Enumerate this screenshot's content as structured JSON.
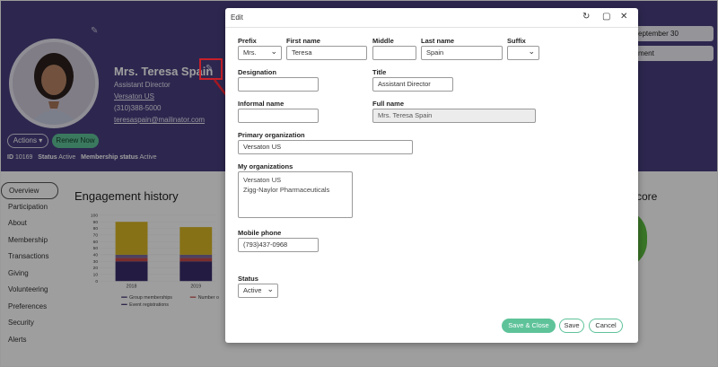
{
  "profile": {
    "name": "Mrs. Teresa Spain",
    "role": "Assistant Director",
    "org": "Versaton US",
    "phone": "(310)388-5000",
    "email": "teresaspain@mailinator.com",
    "actions_label": "Actions ▾",
    "renew_label": "Renew Now",
    "id_label": "ID",
    "id_value": "10169",
    "status_label": "Status",
    "status_value": "Active",
    "membership_status_label": "Membership status",
    "membership_status_value": "Active",
    "date_label": "eptember 30",
    "date2_label": "ment"
  },
  "sidebar": {
    "items": [
      {
        "label": "Overview"
      },
      {
        "label": "Participation"
      },
      {
        "label": "About"
      },
      {
        "label": "Membership"
      },
      {
        "label": "Transactions"
      },
      {
        "label": "Giving"
      },
      {
        "label": "Volunteering"
      },
      {
        "label": "Preferences"
      },
      {
        "label": "Security"
      },
      {
        "label": "Alerts"
      }
    ]
  },
  "main": {
    "engagement_title": "Engagement history",
    "score_title": "core"
  },
  "chart_data": {
    "type": "bar",
    "categories": [
      "2018",
      "2019"
    ],
    "series": [
      {
        "name": "Event registrations",
        "values": [
          30,
          30
        ],
        "color": "#3b2c6b"
      },
      {
        "name": "Number o",
        "values": [
          5,
          5
        ],
        "color": "#c44a4a"
      },
      {
        "name": "Group memberships",
        "values": [
          5,
          5
        ],
        "color": "#7c6a9a"
      },
      {
        "name": "",
        "values": [
          50,
          42
        ],
        "color": "#d9b724"
      }
    ],
    "ylim": [
      0,
      100
    ],
    "yticks": [
      "0",
      "10",
      "20",
      "30",
      "40",
      "50",
      "60",
      "70",
      "80",
      "90",
      "100"
    ],
    "legend": [
      "Group memberships",
      "Number o",
      "Event registrations"
    ]
  },
  "modal": {
    "title": "Edit",
    "labels": {
      "prefix": "Prefix",
      "first_name": "First name",
      "middle": "Middle",
      "last_name": "Last name",
      "suffix": "Suffix",
      "designation": "Designation",
      "title": "Title",
      "informal_name": "Informal name",
      "full_name": "Full name",
      "primary_org": "Primary organization",
      "my_orgs": "My organizations",
      "mobile_phone": "Mobile phone",
      "status": "Status"
    },
    "values": {
      "prefix": "Mrs.",
      "first_name": "Teresa",
      "middle": "",
      "last_name": "Spain",
      "suffix": "",
      "designation": "",
      "title": "Assistant Director",
      "informal_name": "",
      "full_name": "Mrs. Teresa Spain",
      "primary_org": "Versaton US",
      "my_orgs": [
        "Versaton US",
        "Zigg-Naylor Pharmaceuticals"
      ],
      "mobile_phone": "(793)437-0968",
      "status": "Active"
    },
    "buttons": {
      "save_close": "Save & Close",
      "save": "Save",
      "cancel": "Cancel"
    }
  },
  "colors": {
    "header_bg": "#4a3f80",
    "accent_green": "#5fc39a",
    "callout_red": "#c8202a"
  }
}
